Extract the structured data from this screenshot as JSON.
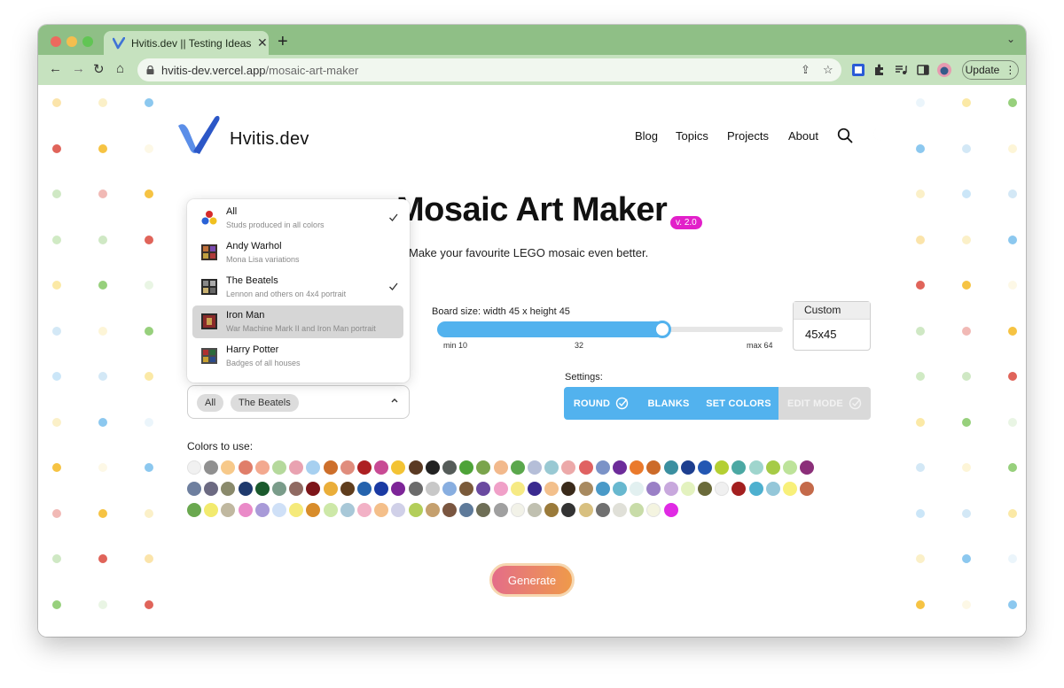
{
  "browser": {
    "tab_title": "Hvitis.dev || Testing Ideas with",
    "tab_close": "✕",
    "new_tab": "+",
    "tab_menu": "⌄",
    "nav": {
      "back": "←",
      "forward": "→",
      "reload": "↻",
      "home": "⌂"
    },
    "url_host": "hvitis-dev.vercel.app",
    "url_path": "/mosaic-art-maker",
    "share_icon": "⇪",
    "bookmark_icon": "☆",
    "update_label": "Update",
    "more_icon": "⋮"
  },
  "site": {
    "brand": "Hvitis.dev",
    "nav": [
      "Blog",
      "Topics",
      "Projects",
      "About"
    ]
  },
  "hero": {
    "title": "Mosaic Art Maker",
    "version": "v. 2.0",
    "subtitle": "Make your favourite LEGO mosaic even better."
  },
  "board": {
    "label": "Board size:  width 45 x height 45",
    "min": 10,
    "max": 64,
    "value": 45,
    "min_label": "min 10",
    "mid_label": "32",
    "max_label": "max 64",
    "custom_title": "Custom",
    "custom_value": "45x45"
  },
  "settings": {
    "label": "Settings:",
    "buttons": [
      {
        "label": "ROUND",
        "active": true,
        "checked": true
      },
      {
        "label": "BLANKS",
        "active": true,
        "checked": false
      },
      {
        "label": "SET COLORS",
        "active": true,
        "checked": false
      },
      {
        "label": "EDIT MODE",
        "active": false,
        "checked": true
      }
    ]
  },
  "sets_select": {
    "chips": [
      "All",
      "The Beatels"
    ],
    "options": [
      {
        "label": "All",
        "desc": "Studs produced in all colors",
        "checked": true,
        "hover": false
      },
      {
        "label": "Andy Warhol",
        "desc": "Mona Lisa variations",
        "checked": false,
        "hover": false
      },
      {
        "label": "The Beatels",
        "desc": "Lennon and others on 4x4 portrait",
        "checked": true,
        "hover": false
      },
      {
        "label": "Iron Man",
        "desc": "War Machine Mark II and Iron Man portrait",
        "checked": false,
        "hover": true
      },
      {
        "label": "Harry Potter",
        "desc": "Badges of all houses",
        "checked": false,
        "hover": false
      }
    ]
  },
  "colors": {
    "label": "Colors to use:",
    "rows": [
      [
        "#f1f1f1",
        "#909090",
        "#f7c98a",
        "#e07e6a",
        "#f3a98f",
        "#b5d99c",
        "#e9a2b1",
        "#a7d0f0",
        "#cd6f2b",
        "#e08d7d",
        "#ad2022",
        "#c84a94",
        "#f3c334",
        "#5a3a23",
        "#222222",
        "#555c59",
        "#4ea338",
        "#7aa44c",
        "#f2b98c",
        "#5aa74c",
        "#b5bed8",
        "#99c9d3",
        "#eca9a9",
        "#e06262",
        "#7b93c7",
        "#6d2c9a",
        "#ea7a2c",
        "#cc6b29",
        "#3b8fa0",
        "#1d3e8f",
        "#2357b3",
        "#b4cf33",
        "#4ba8a3",
        "#9fd5cd",
        "#a6cb46",
        "#bde39a",
        "#8b2f79"
      ],
      [
        "#6e7f9f",
        "#6c6a82",
        "#8a8a6c",
        "#1f3a6d",
        "#1b5a2d",
        "#7a9c8a",
        "#906a62",
        "#7d1519",
        "#eaae3a",
        "#5f3d1d",
        "#2563ad",
        "#1a3aa3",
        "#7d2598",
        "#6b6b6b",
        "#c8c8c8",
        "#88aee0",
        "#7a5a3a",
        "#6a4aa0",
        "#f0a0c8",
        "#f6ea84",
        "#3a2a8f",
        "#f3c08c",
        "#3a2a1a",
        "#a88a60",
        "#4a9ac8",
        "#68b8cf",
        "#e2f0f0",
        "#9a80c6",
        "#c8a8dd",
        "#e3f2bf",
        "#6a6a3a",
        "#f0f0f0",
        "#a31f1f",
        "#4db0cf",
        "#94c7d9",
        "#f8f07a",
        "#c46a4a"
      ],
      [
        "#6aa84f",
        "#f2ea6e",
        "#c0b8a0",
        "#ea8ac8",
        "#a89ad8",
        "#cfe0f7",
        "#f5ea7a",
        "#d88c2a",
        "#cde8a8",
        "#a8c8d8",
        "#f2b1c6",
        "#f4bf8a",
        "#d0d0e8",
        "#b3ce5a",
        "#c5a06e",
        "#7a5640",
        "#5e7a9a",
        "#6e6e56",
        "#a0a0a0",
        "#f2f2e8",
        "#c0c0b0",
        "#9a7a3a",
        "#333333",
        "#d8c080",
        "#707070",
        "#e0e0d8",
        "#c8dca8",
        "#f4f4e0",
        "#e02ae4"
      ]
    ]
  },
  "generate_label": "Generate"
}
